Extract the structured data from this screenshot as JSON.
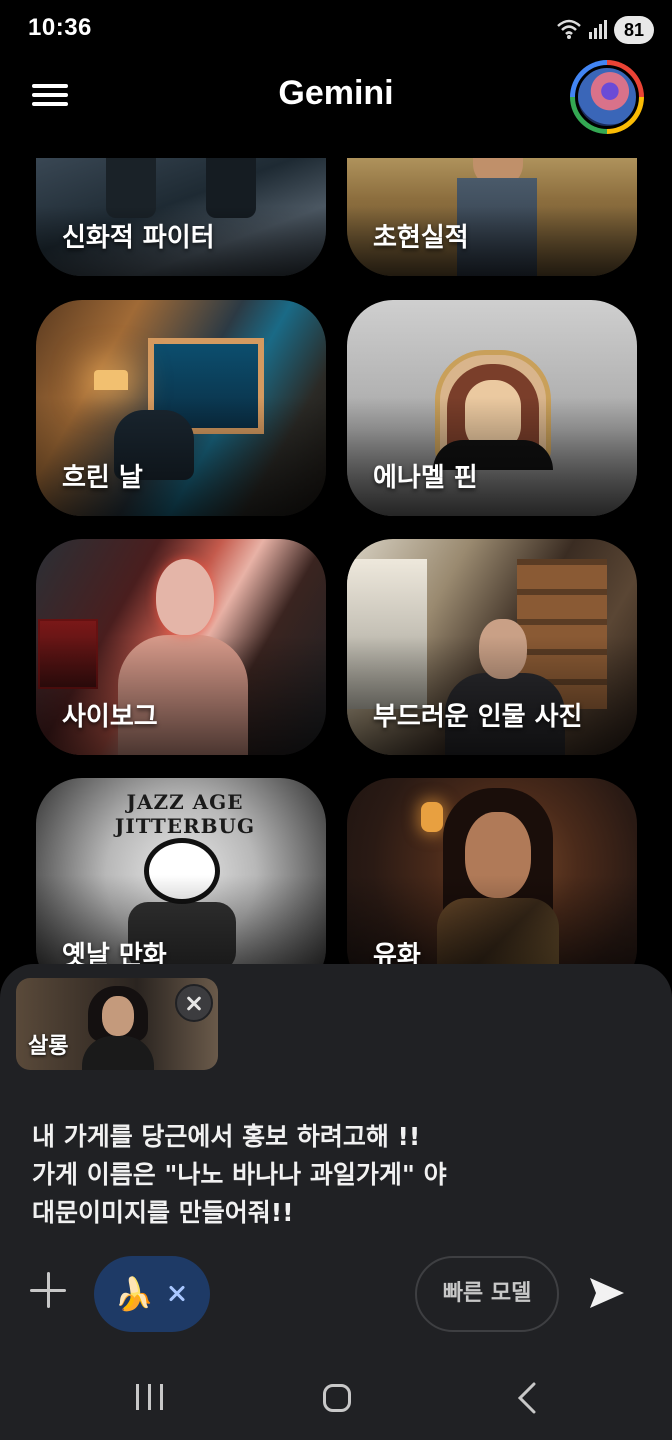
{
  "status_bar": {
    "time": "10:36",
    "battery": "81"
  },
  "header": {
    "title": "Gemini"
  },
  "styles": [
    {
      "label": "신화적 파이터"
    },
    {
      "label": "초현실적"
    },
    {
      "label": "흐린 날"
    },
    {
      "label": "에나멜 핀"
    },
    {
      "label": "사이보그"
    },
    {
      "label": "부드러운 인물 사진"
    },
    {
      "label": "옛날 만화"
    },
    {
      "label": "유화"
    }
  ],
  "cartoon_text": "JAZZ AGE JITTERBUG",
  "composer": {
    "selected_style": {
      "label": "살롱"
    },
    "prompt_lines": [
      "내 가게를 당근에서 홍보 하려고해 !!",
      "가게 이름은 \"나노 바나나 과일가게\" 야",
      "대문이미지를 만들어줘!!"
    ],
    "tool_chip_emoji": "🍌",
    "model_label": "빠른 모델"
  },
  "colors": {
    "background": "#000000",
    "panel": "#202124",
    "tool_chip": "#1e3a66"
  }
}
